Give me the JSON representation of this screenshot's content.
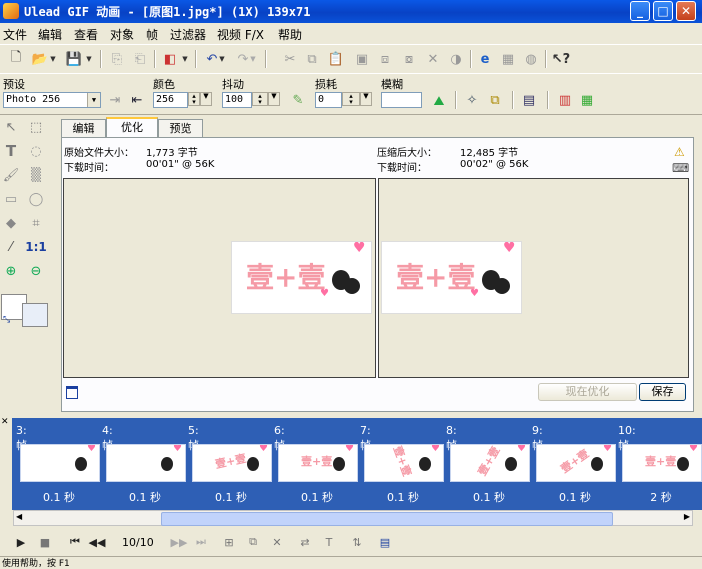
{
  "window": {
    "title": "Ulead GIF 动画 - [原图1.jpg*] (1X) 139x71",
    "buttons": {
      "minimize": "_",
      "maximize": "□",
      "close": "✕"
    }
  },
  "menu": [
    "文件",
    "编辑",
    "查看",
    "对象",
    "帧",
    "过滤器",
    "视频 F/X",
    "帮助"
  ],
  "settings": {
    "preset_label": "预设",
    "preset_value": "Photo 256",
    "colors_label": "颜色",
    "colors_value": "256",
    "dither_label": "抖动",
    "dither_value": "100",
    "lossy_label": "损耗",
    "lossy_value": "0",
    "blur_label": "模糊",
    "blur_value": ""
  },
  "tabs": [
    "编辑",
    "优化",
    "预览"
  ],
  "active_tab": "优化",
  "optimize": {
    "orig_size_label": "原始文件大小：",
    "orig_size_value": "1,773 字节",
    "orig_time_label": "下载时间：",
    "orig_time_value": "00'01\" @ 56K",
    "comp_size_label": "压缩后大小：",
    "comp_size_value": "12,485 字节",
    "comp_time_label": "下载时间：",
    "comp_time_value": "00'02\" @ 56K",
    "image_text": "壹+壹",
    "optimize_now_button": "现在优化",
    "save_button": "保存"
  },
  "frames": [
    {
      "num": "3:帧",
      "delay": "0.1 秒"
    },
    {
      "num": "4:帧",
      "delay": "0.1 秒"
    },
    {
      "num": "5:帧",
      "delay": "0.1 秒"
    },
    {
      "num": "6:帧",
      "delay": "0.1 秒"
    },
    {
      "num": "7:帧",
      "delay": "0.1 秒"
    },
    {
      "num": "8:帧",
      "delay": "0.1 秒"
    },
    {
      "num": "9:帧",
      "delay": "0.1 秒"
    },
    {
      "num": "10:帧",
      "delay": "2 秒"
    }
  ],
  "playback": {
    "frame_counter": "10/10"
  },
  "zoom_label": "1:1",
  "statusbar": {
    "text": "使用帮助，按 F1"
  },
  "colors": {
    "titlebar": "#0842c5",
    "framestrip": "#2e5fb5",
    "image_pink": "#f59aa6"
  }
}
